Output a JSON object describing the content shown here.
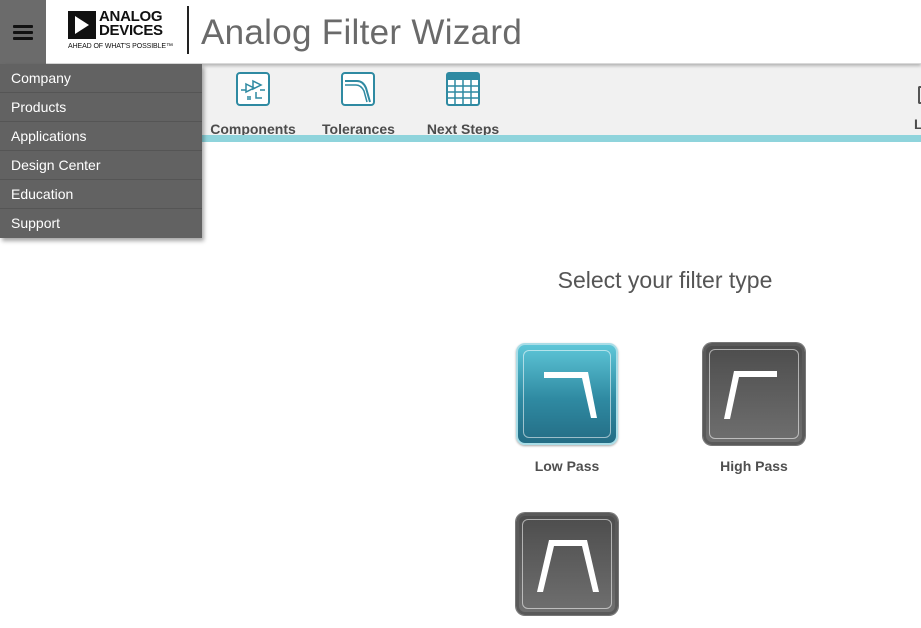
{
  "header": {
    "logo_line1": "ANALOG",
    "logo_line2": "DEVICES",
    "logo_tagline": "AHEAD OF WHAT'S POSSIBLE™",
    "app_title": "Analog Filter Wizard"
  },
  "nav_menu": {
    "items": [
      {
        "label": "Company"
      },
      {
        "label": "Products"
      },
      {
        "label": "Applications"
      },
      {
        "label": "Design Center"
      },
      {
        "label": "Education"
      },
      {
        "label": "Support"
      }
    ]
  },
  "toolbar": {
    "steps": [
      {
        "label": "Components",
        "icon": "circuit-icon"
      },
      {
        "label": "Tolerances",
        "icon": "tolerance-curve-icon"
      },
      {
        "label": "Next Steps",
        "icon": "table-grid-icon"
      },
      {
        "label": "L",
        "icon": "partial-icon"
      }
    ],
    "accent_color": "#8fd4dc"
  },
  "main": {
    "prompt": "Select your filter type",
    "filters": [
      {
        "label": "Low Pass",
        "icon": "low-pass-icon",
        "selected": true,
        "color": "#2f8aa2"
      },
      {
        "label": "High Pass",
        "icon": "high-pass-icon",
        "selected": false,
        "color": "#5a5a5a"
      },
      {
        "label": "",
        "icon": "band-pass-icon",
        "selected": false,
        "color": "#5a5a5a"
      }
    ]
  }
}
